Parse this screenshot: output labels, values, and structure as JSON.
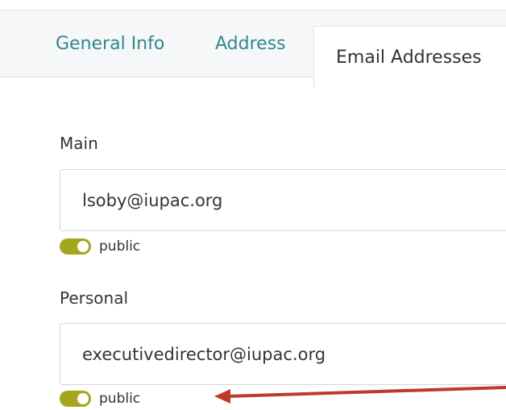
{
  "tabs": [
    {
      "label": "General Info",
      "active": false
    },
    {
      "label": "Address",
      "active": false
    },
    {
      "label": "Email Addresses",
      "active": true
    }
  ],
  "emails": [
    {
      "label": "Main",
      "value": "lsoby@iupac.org",
      "visibility": "public",
      "public_enabled": true
    },
    {
      "label": "Personal",
      "value": "executivedirector@iupac.org",
      "visibility": "public",
      "public_enabled": true
    }
  ],
  "colors": {
    "tab_link": "#2d8a8c",
    "toggle_on": "#a5a61d",
    "annotation_arrow": "#c0392b"
  }
}
